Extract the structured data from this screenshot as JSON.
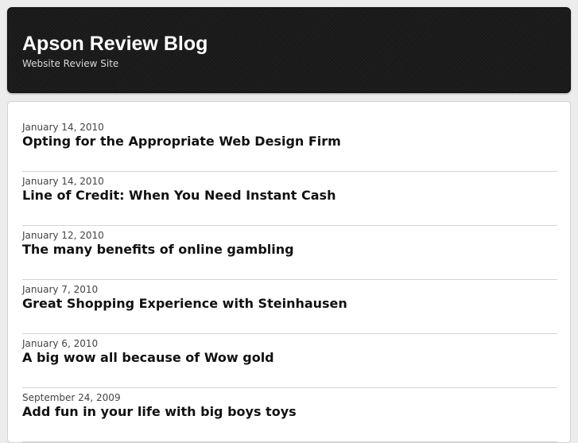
{
  "header": {
    "title": "Apson Review Blog",
    "tagline": "Website Review Site"
  },
  "posts": [
    {
      "date": "January 14, 2010",
      "title": "Opting for the Appropriate Web Design Firm"
    },
    {
      "date": "January 14, 2010",
      "title": "Line of Credit: When You Need Instant Cash"
    },
    {
      "date": "January 12, 2010",
      "title": "The many benefits of online gambling"
    },
    {
      "date": "January 7, 2010",
      "title": "Great Shopping Experience with Steinhausen"
    },
    {
      "date": "January 6, 2010",
      "title": "A big wow all because of Wow gold"
    },
    {
      "date": "September 24, 2009",
      "title": "Add fun in your life with big boys toys"
    }
  ],
  "colors": {
    "header_background": "#1c1c1c",
    "page_background": "#ececec",
    "content_background": "#ffffff",
    "title_text": "#ffffff",
    "post_title_text": "#111111"
  }
}
